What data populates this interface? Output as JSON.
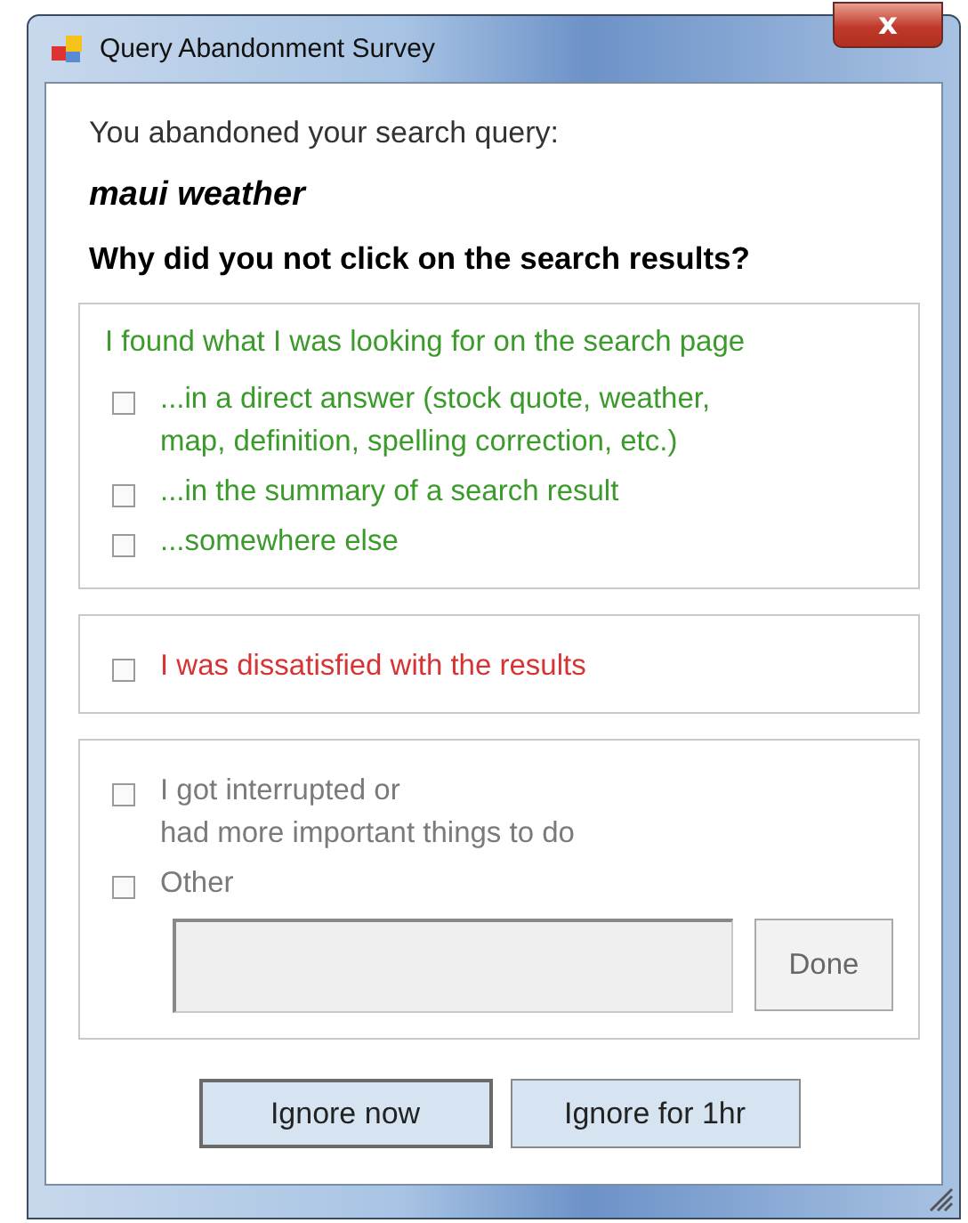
{
  "window": {
    "title": "Query Abandonment Survey",
    "close": "x"
  },
  "prompt": "You abandoned your search query:",
  "query": "maui weather",
  "question": "Why did you not click on the search results?",
  "groups": [
    {
      "heading": "I found what I was looking for on the search page",
      "color": "#3a9a2a",
      "items": [
        {
          "kind": "checkbox",
          "label": "...in a direct answer (stock quote, weather,\nmap, definition, spelling correction, etc.)",
          "checked": false
        },
        {
          "kind": "checkbox",
          "label": "...in the summary of a search result",
          "checked": false
        },
        {
          "kind": "checkbox",
          "label": "...somewhere else",
          "checked": false
        }
      ]
    },
    {
      "color": "#d63434",
      "items": [
        {
          "kind": "checkbox",
          "label": "I was dissatisfied with the results",
          "checked": false
        }
      ]
    },
    {
      "color": "#7a7a7a",
      "items": [
        {
          "kind": "checkbox",
          "label": "I got interrupted or\nhad more important things to do",
          "checked": false
        },
        {
          "kind": "checkbox",
          "label": "Other",
          "checked": false
        },
        {
          "kind": "entry",
          "button": "Done"
        }
      ]
    }
  ],
  "buttons": [
    "Ignore now",
    "Ignore for 1hr"
  ]
}
